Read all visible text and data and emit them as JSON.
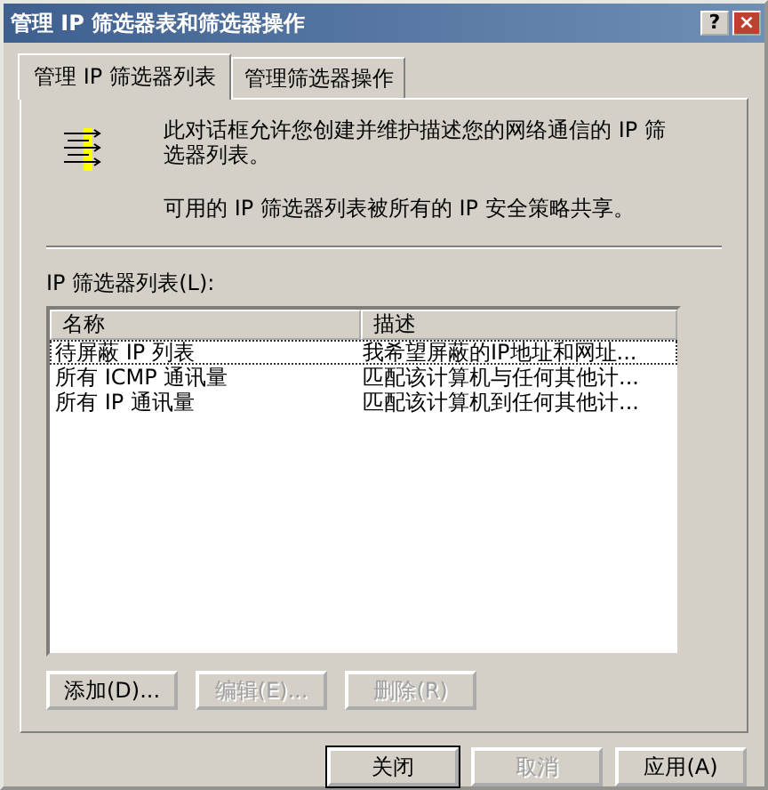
{
  "window": {
    "title": "管理 IP 筛选器表和筛选器操作",
    "controls": [
      "?",
      "×"
    ]
  },
  "tabs": [
    {
      "label": "管理 IP 筛选器列表",
      "selected": true
    },
    {
      "label": "管理筛选器操作",
      "selected": false
    }
  ],
  "intro": {
    "paragraphs": [
      "此对话框允许您创建并维护描述您的网络通信的 IP 筛选器列表。",
      "可用的 IP 筛选器列表被所有的 IP 安全策略共享。"
    ]
  },
  "list": {
    "label": "IP 筛选器列表(L):",
    "columns": [
      "名称",
      "描述"
    ],
    "rows": [
      {
        "name": "待屏蔽 IP 列表",
        "description": "我希望屏蔽的IP地址和网址...",
        "focused": true
      },
      {
        "name": "所有 ICMP 通讯量",
        "description": "匹配该计算机与任何其他计...",
        "focused": false
      },
      {
        "name": "所有 IP 通讯量",
        "description": "匹配该计算机到任何其他计...",
        "focused": false
      }
    ]
  },
  "list_buttons": [
    {
      "label": "添加(D)...",
      "disabled": false
    },
    {
      "label": "编辑(E)...",
      "disabled": true
    },
    {
      "label": "删除(R)",
      "disabled": true
    }
  ],
  "dialog_buttons": [
    {
      "label": "关闭",
      "disabled": false,
      "default": true
    },
    {
      "label": "取消",
      "disabled": true,
      "default": false
    },
    {
      "label": "应用(A)",
      "disabled": false,
      "default": false
    }
  ]
}
